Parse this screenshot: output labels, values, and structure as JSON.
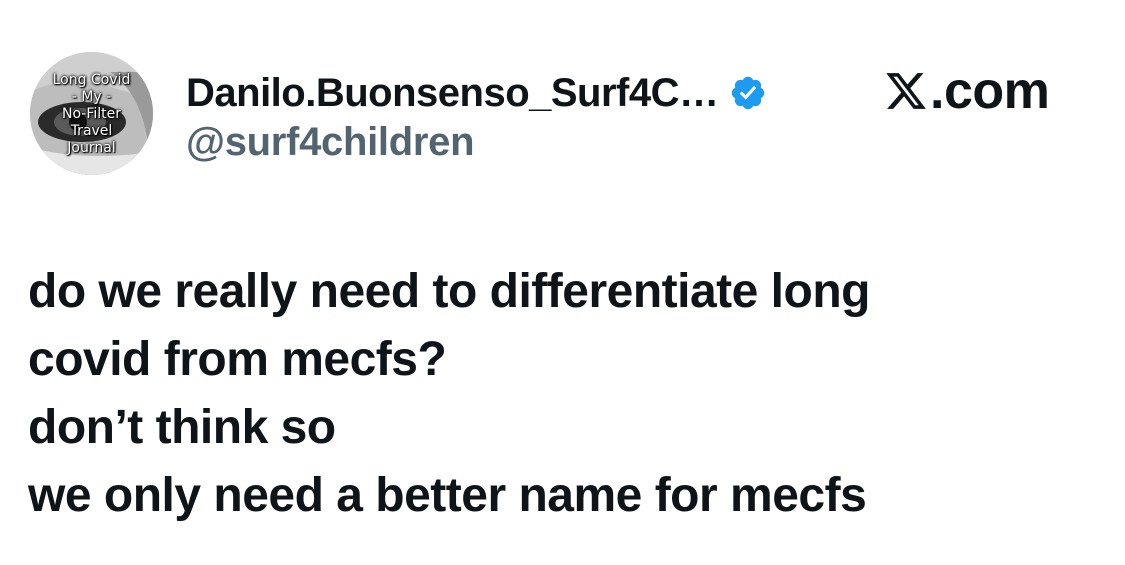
{
  "avatar": {
    "lines": [
      "Long Covid",
      "- My -",
      "No-Filter",
      "Travel",
      "Journal"
    ]
  },
  "author": {
    "display_name": "Danilo.Buonsenso_Surf4C…",
    "handle": "@surf4children",
    "verified": true,
    "verified_color": "#1d9bf0"
  },
  "site": {
    "logo_icon": "x-logo-icon",
    "label": ".com"
  },
  "tweet": {
    "lines": [
      "do we really need to differentiate long",
      "covid from mecfs?",
      "don’t think so",
      "we only need a better name for mecfs"
    ]
  }
}
